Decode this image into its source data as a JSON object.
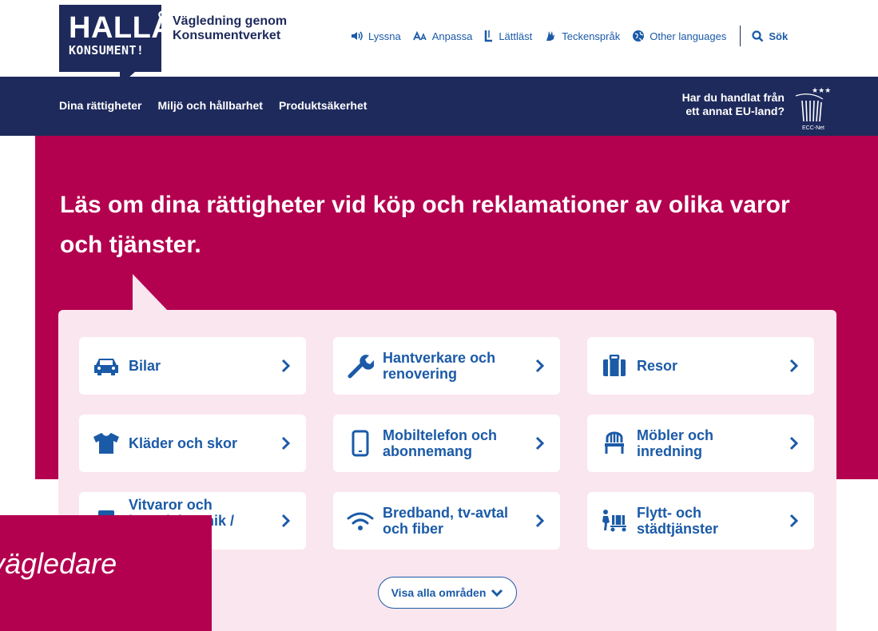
{
  "logo": {
    "main": "HALLÅ",
    "sub": "KONSUMENT!"
  },
  "tagline": {
    "line1": "Vägledning genom",
    "line2": "Konsumentverket"
  },
  "tools": [
    {
      "label": "Lyssna",
      "icon": "speaker-icon"
    },
    {
      "label": "Anpassa",
      "icon": "font-size-icon"
    },
    {
      "label": "Lättläst",
      "icon": "easy-read-icon"
    },
    {
      "label": "Teckenspråk",
      "icon": "sign-language-icon"
    },
    {
      "label": "Other languages",
      "icon": "globe-icon"
    }
  ],
  "search_label": "Sök",
  "nav": [
    "Dina rättigheter",
    "Miljö och hållbarhet",
    "Produktsäkerhet"
  ],
  "eu_link": {
    "line1": "Har du handlat från",
    "line2": "ett annat EU-land?"
  },
  "ecc_label": "ECC-Net",
  "hero": {
    "title": "Läs om dina rättigheter vid köp och reklamationer av olika varor och tjänster."
  },
  "cards": [
    {
      "label": "Bilar",
      "icon": "car-icon"
    },
    {
      "label": "Hantverkare och renovering",
      "icon": "wrench-icon"
    },
    {
      "label": "Resor",
      "icon": "suitcase-icon"
    },
    {
      "label": "Kläder och skor",
      "icon": "tshirt-icon"
    },
    {
      "label": "Mobiltelefon och abonnemang",
      "icon": "mobile-phone-icon"
    },
    {
      "label": "Möbler och inredning",
      "icon": "chair-icon"
    },
    {
      "label": "Vitvaror och hemelektronik / apparater",
      "icon": "appliance-icon"
    },
    {
      "label": "Bredband, tv-avtal och fiber",
      "icon": "wifi-icon"
    },
    {
      "label": "Flytt- och städtjänster",
      "icon": "moving-icon"
    }
  ],
  "show_all_label": "Visa alla områden",
  "overlay_text": "vägledare",
  "colors": {
    "navy": "#1e2a5c",
    "magenta": "#b3004f",
    "link_blue": "#1b5aa7",
    "panel_pink": "#fae6ee"
  }
}
